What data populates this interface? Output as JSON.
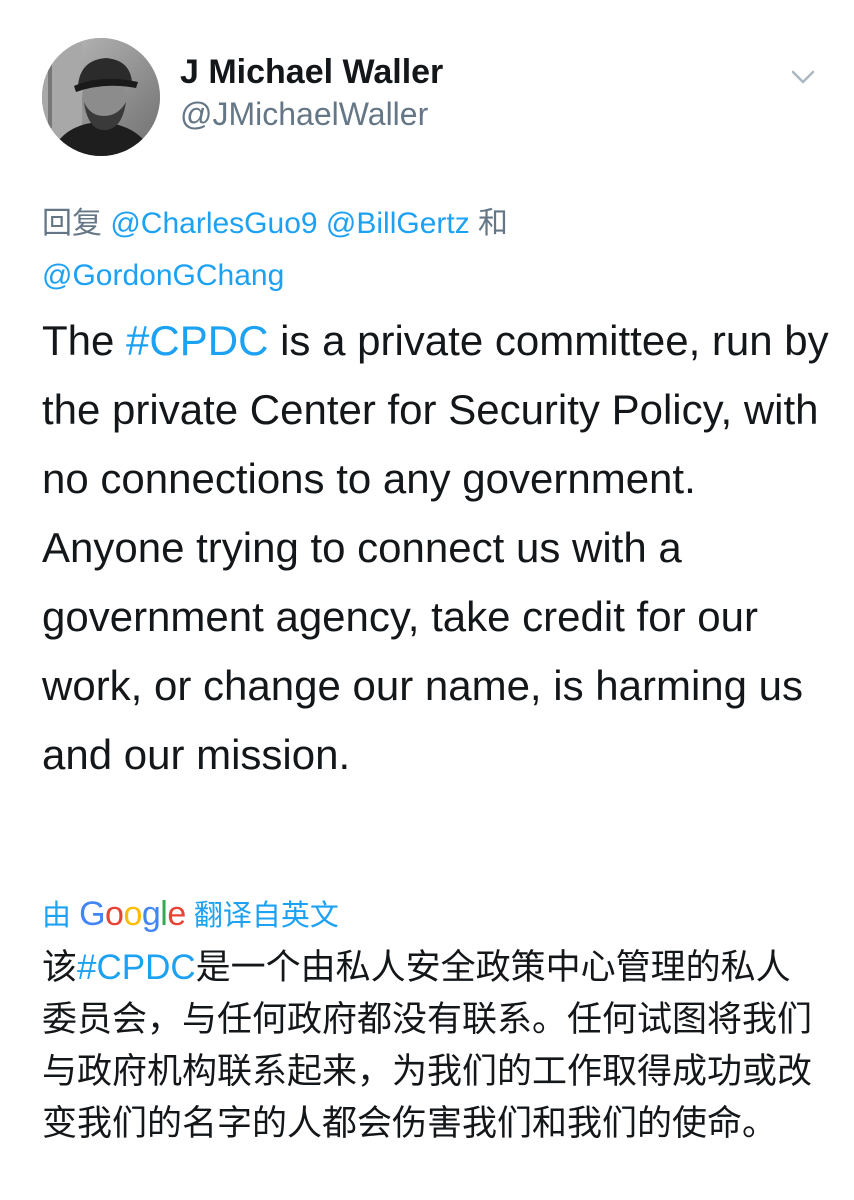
{
  "author": {
    "display_name": "J Michael Waller",
    "handle": "@JMichaelWaller",
    "avatar_icon": "profile-photo"
  },
  "menu": {
    "icon": "chevron-down-icon"
  },
  "reply": {
    "prefix": "回复 ",
    "mentions": [
      "@CharlesGuo9",
      "@BillGertz"
    ],
    "conjunction": " 和",
    "last_mention": "@GordonGChang"
  },
  "tweet": {
    "before_hashtag": "The ",
    "hashtag": "#CPDC",
    "after_hashtag": " is a private committee, run by the private Center for Security Policy, with no connections to any government. Anyone trying to connect us with a government agency, take credit for our work, or change our name, is harming us and our mission."
  },
  "translation": {
    "by_label": "由 ",
    "google_letters": [
      "G",
      "o",
      "o",
      "g",
      "l",
      "e"
    ],
    "google_colors": [
      "#4285F4",
      "#EA4335",
      "#FBBC05",
      "#4285F4",
      "#34A853",
      "#EA4335"
    ],
    "suffix": " 翻译自英文",
    "text_before_hashtag": "该",
    "hashtag": "#CPDC",
    "text_after_hashtag": "是一个由私人安全政策中心管理的私人委员会，与任何政府都没有联系。任何试图将我们与政府机构联系起来，为我们的工作取得成功或改变我们的名字的人都会伤害我们和我们的使命。"
  },
  "colors": {
    "link": "#1da1f2",
    "secondary_text": "#657786",
    "primary_text": "#14171a"
  }
}
